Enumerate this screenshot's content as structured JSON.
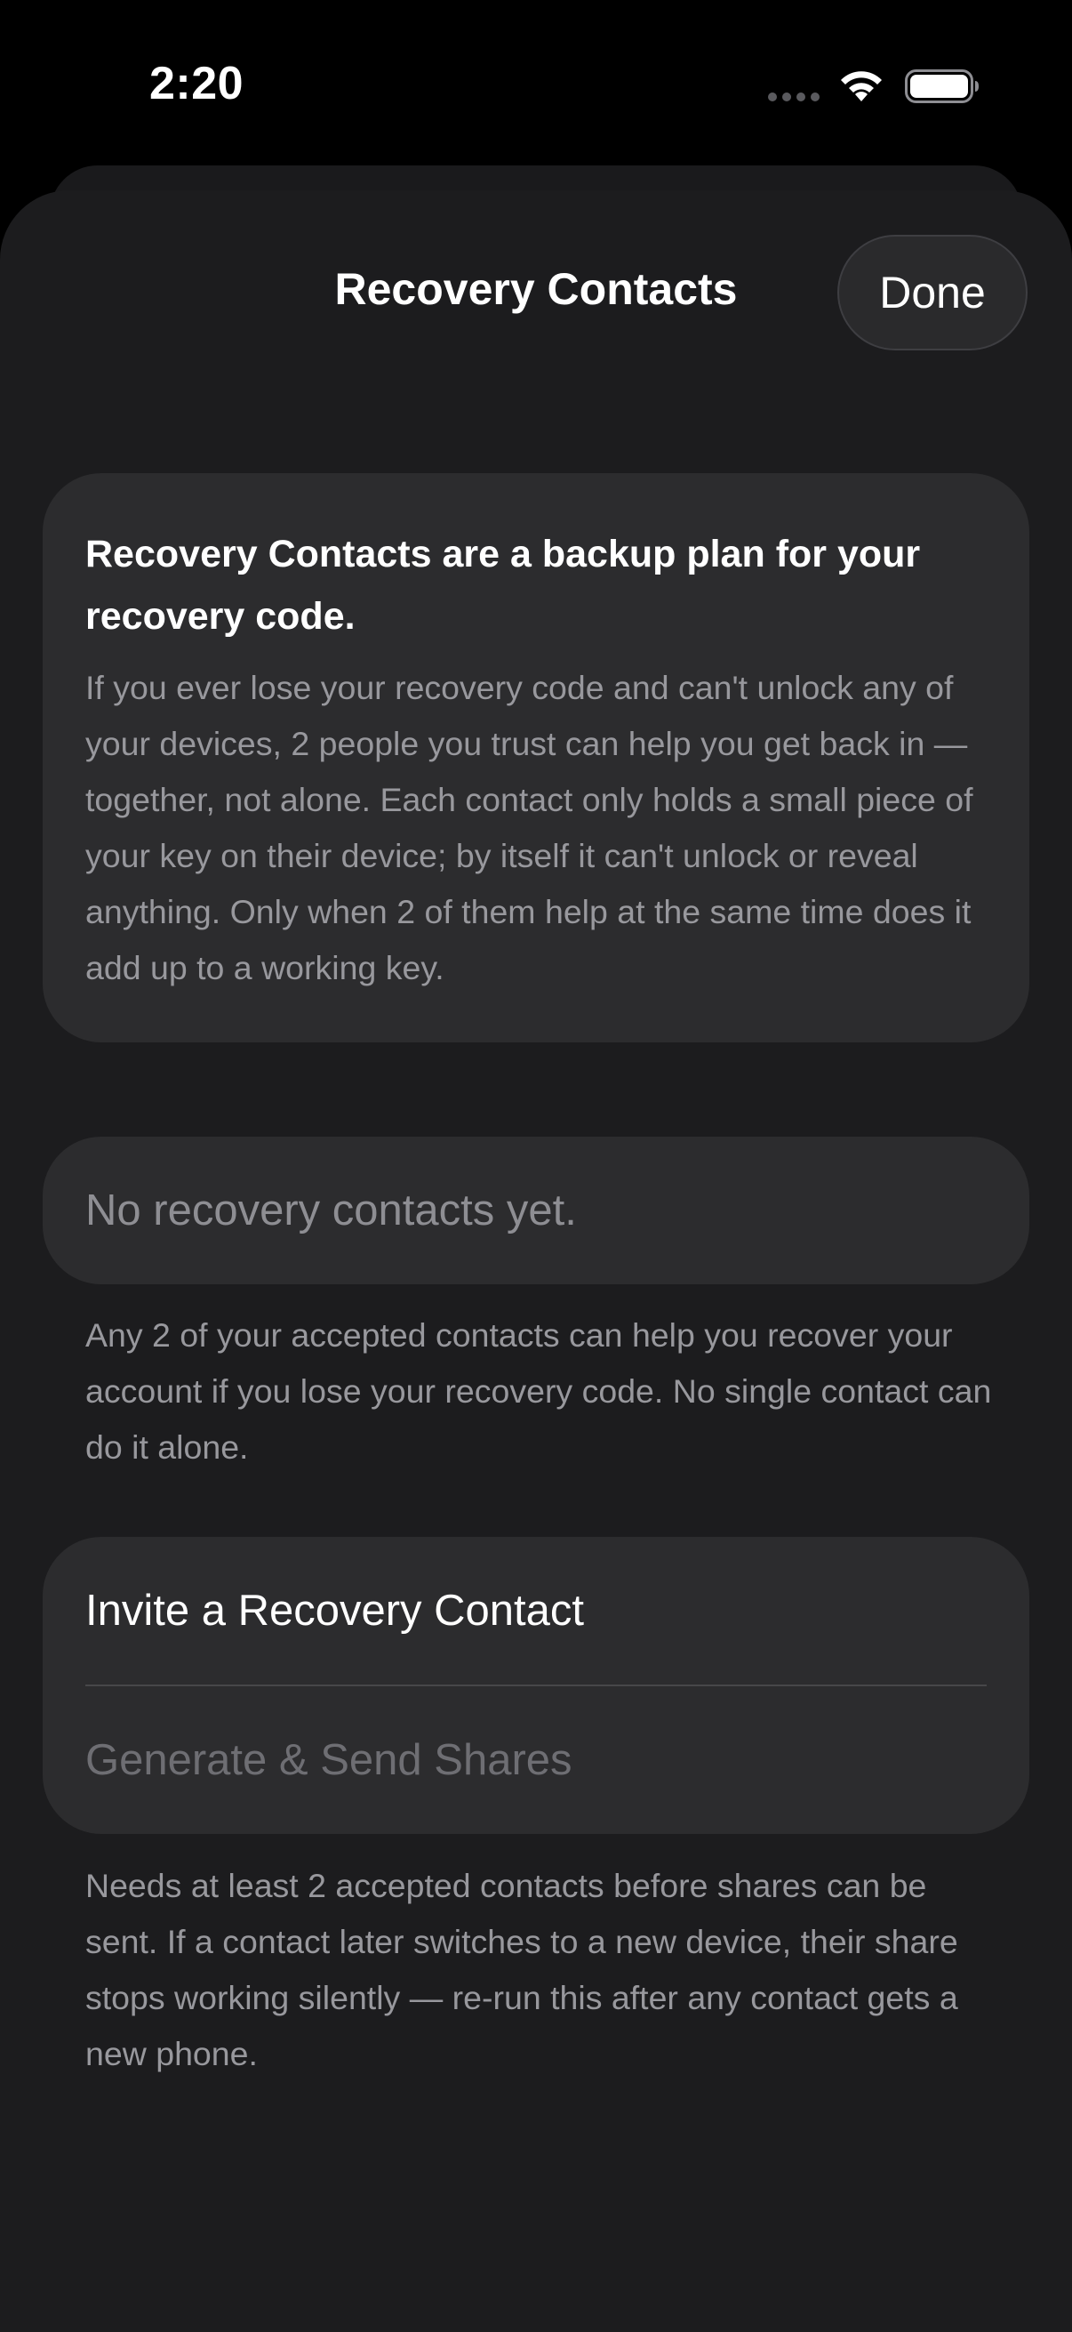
{
  "status_bar": {
    "time": "2:20"
  },
  "nav": {
    "title": "Recovery Contacts",
    "done_label": "Done"
  },
  "info_card": {
    "title": "Recovery Contacts are a backup plan for your recovery code.",
    "body": "If you ever lose your recovery code and can't unlock any of your devices, 2 people you trust can help you get back in — together, not alone. Each contact only holds a small piece of your key on their device; by itself it can't unlock or reveal anything. Only when 2 of them help at the same time does it add up to a working key."
  },
  "contacts_section": {
    "empty_text": "No recovery contacts yet.",
    "footnote": "Any 2 of your accepted contacts can help you recover your account if you lose your recovery code. No single contact can do it alone."
  },
  "actions_section": {
    "invite_label": "Invite a Recovery Contact",
    "generate_label": "Generate & Send Shares",
    "footnote": "Needs at least 2 accepted contacts before shares can be sent. If a contact later switches to a new device, their share stops working silently — re-run this after any contact gets a new phone."
  },
  "colors": {
    "background": "#000000",
    "sheet": "#1c1c1e",
    "card": "#2c2c2e",
    "primary_text": "#ffffff",
    "secondary_text": "#98989d",
    "disabled_text": "#6e6e73"
  }
}
